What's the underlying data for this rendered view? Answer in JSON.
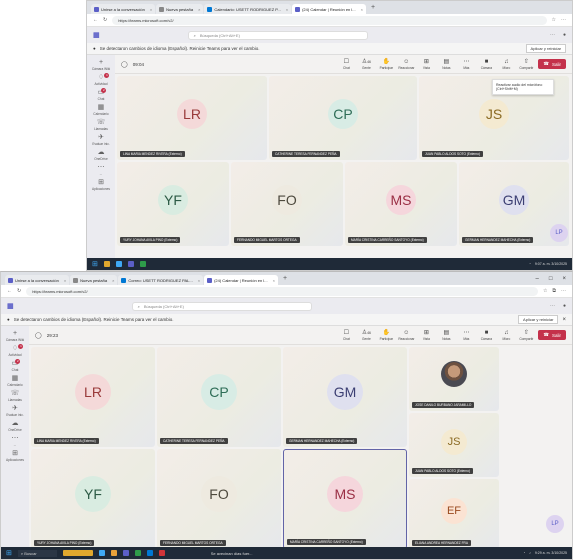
{
  "browser": {
    "tabs": [
      {
        "label": "Unirse a la conversación",
        "color": "#5b5fc7"
      },
      {
        "label": "Nueva pestaña",
        "color": "#888888"
      },
      {
        "label": "Correo: USETT RODRIGUEZ PAL...",
        "color": "#0078d4"
      },
      {
        "label": "(24) Calendar | Reunión en l...",
        "color": "#5b5fc7"
      }
    ],
    "tabs_top": [
      {
        "label": "Unirse a la conversación",
        "color": "#5b5fc7"
      },
      {
        "label": "Nueva pestaña",
        "color": "#888888"
      },
      {
        "label": "Calendario: USETT RODRIGUEZ P...",
        "color": "#0078d4"
      },
      {
        "label": "(24) Calendar | Reunión en l...",
        "color": "#5b5fc7"
      }
    ],
    "new_tab": "+",
    "url": "https://teams.microsoft.com/v2/"
  },
  "teams": {
    "search_placeholder": "Búsqueda (Ctrl+Alt+E)",
    "notice": "Se detectaron cambios de idioma (Español). Reinicie Teams para ver el cambio.",
    "notice_button": "Aplicar y reiniciar",
    "rail": [
      {
        "label": "Cámara Wiki",
        "icon": "plus-icon"
      },
      {
        "label": "Actividad",
        "icon": "bell-icon",
        "badge": "1"
      },
      {
        "label": "Chat",
        "icon": "chat-icon",
        "badge": "2"
      },
      {
        "label": "Calendario",
        "icon": "calendar-icon"
      },
      {
        "label": "Llamadas",
        "icon": "phone-icon"
      },
      {
        "label": "Evaluar inic.",
        "icon": "rocket-icon"
      },
      {
        "label": "OneDrive",
        "icon": "cloud-icon"
      },
      {
        "label": "...",
        "icon": "more-icon"
      },
      {
        "label": "Aplicaciones",
        "icon": "apps-icon"
      }
    ],
    "timer_top": "09:04",
    "timer_bottom": "29:23",
    "tools": [
      {
        "label": "Chat",
        "glyph": "☐"
      },
      {
        "label": "Gente",
        "glyph": "♙"
      },
      {
        "label": "Participar",
        "glyph": "✋"
      },
      {
        "label": "Reaccionar",
        "glyph": "☺"
      },
      {
        "label": "Vista",
        "glyph": "⊞"
      },
      {
        "label": "Notas",
        "glyph": "▤"
      },
      {
        "label": "Más",
        "glyph": "⋯"
      },
      {
        "label": "Cámara",
        "glyph": "■"
      },
      {
        "label": "Micro",
        "glyph": "♫"
      },
      {
        "label": "Compartir",
        "glyph": "⇧"
      }
    ],
    "people_count": "46",
    "leave": "Salir",
    "tooltip": "Reactivar audio del micrófono (Ctrl+Shift+M)"
  },
  "top_tiles": [
    {
      "initials": "LR",
      "name": "LINA MARIA MENDEZ RIVERA (Externo)",
      "color": "#f4d9d9",
      "text": "#9a3b3b"
    },
    {
      "initials": "CP",
      "name": "CATHERINE TERESA FERNANDEZ PEÑA",
      "color": "#d8ece5",
      "text": "#2e6d57"
    },
    {
      "initials": "JS",
      "name": "JUAN PABLO ALDOS SOTO (Externo)",
      "color": "#f4ead1",
      "text": "#8a6a22"
    },
    {
      "initials": "YF",
      "name": "YURY JOHANA AVILA PINO (Externo)",
      "color": "#d9ece1",
      "text": "#2c5a45"
    },
    {
      "initials": "FO",
      "name": "FERNANDO MIGUEL MARTOS ORTEGA",
      "color": "#eeeae0",
      "text": "#4e4a3e"
    },
    {
      "initials": "MS",
      "name": "MARÍA CRISTINA CARREÑO SANTOYO (Externo)",
      "color": "#f5d6dc",
      "text": "#9a2f45"
    },
    {
      "initials": "GM",
      "name": "GERMAN HERNANDEZ MAHECHA (Externo)",
      "color": "#dfe0ef",
      "text": "#3c3f73"
    }
  ],
  "bottom_tiles": [
    {
      "initials": "LR",
      "name": "LINA MARIA MENDEZ RIVERA (Externo)",
      "color": "#f4d9d9",
      "text": "#9a3b3b"
    },
    {
      "initials": "CP",
      "name": "CATHERINE TERESA FERNANDEZ PEÑA",
      "color": "#d8ece5",
      "text": "#2e6d57"
    },
    {
      "initials": "GM",
      "name": "GERMAN HERNANDEZ MAHECHA (Externo)",
      "color": "#dfe0ef",
      "text": "#3c3f73"
    },
    {
      "initials": "",
      "name": "JOSE DANILO BURBANO JARAMILLO",
      "color": "#eeeeee",
      "text": "#333333"
    },
    {
      "initials": "JS",
      "name": "JUAN PABLO ALDOS SOTO (Externo)",
      "color": "#f4ead1",
      "text": "#8a6a22"
    },
    {
      "initials": "YF",
      "name": "YURY JOHANA AVILA PINO (Externo)",
      "color": "#d9ece1",
      "text": "#2c5a45"
    },
    {
      "initials": "FO",
      "name": "FERNANDO MIGUEL MARTOS ORTEGA",
      "color": "#eeeae0",
      "text": "#4e4a3e"
    },
    {
      "initials": "MS",
      "name": "MARÍA CRISTINA CARREÑO SANTOYO (Externo)",
      "color": "#f5d6dc",
      "text": "#9a2f45"
    },
    {
      "initials": "EF",
      "name": "ELIANA ANDREA HERNANDEZ FRA",
      "color": "#fbe3d3",
      "text": "#9a4a1f"
    }
  ],
  "self_avatar": "LP",
  "taskbar": {
    "search": "Buscar",
    "status": "Se avecinan días fuer...",
    "time_top": "9:07 a. m. 3/10/2025",
    "time_bottom": "9:29 a. m. 3/10/2025"
  }
}
